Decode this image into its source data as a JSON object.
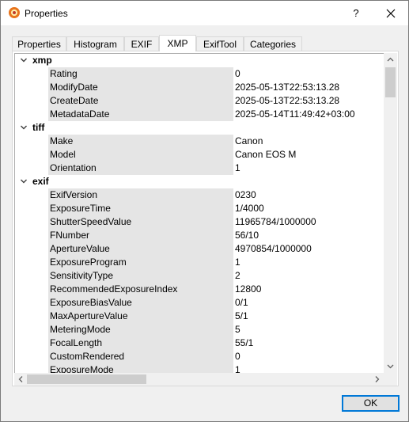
{
  "window": {
    "title": "Properties",
    "help": "?",
    "close": "✕"
  },
  "tabs": [
    "Properties",
    "Histogram",
    "EXIF",
    "XMP",
    "ExifTool",
    "Categories"
  ],
  "active_tab": "XMP",
  "groups": [
    {
      "name": "xmp",
      "rows": [
        {
          "k": "Rating",
          "v": "0"
        },
        {
          "k": "ModifyDate",
          "v": "2025-05-13T22:53:13.28"
        },
        {
          "k": "CreateDate",
          "v": "2025-05-13T22:53:13.28"
        },
        {
          "k": "MetadataDate",
          "v": "2025-05-14T11:49:42+03:00"
        }
      ]
    },
    {
      "name": "tiff",
      "rows": [
        {
          "k": "Make",
          "v": "Canon"
        },
        {
          "k": "Model",
          "v": "Canon EOS M"
        },
        {
          "k": "Orientation",
          "v": "1"
        }
      ]
    },
    {
      "name": "exif",
      "rows": [
        {
          "k": "ExifVersion",
          "v": "0230"
        },
        {
          "k": "ExposureTime",
          "v": "1/4000"
        },
        {
          "k": "ShutterSpeedValue",
          "v": "11965784/1000000"
        },
        {
          "k": "FNumber",
          "v": "56/10"
        },
        {
          "k": "ApertureValue",
          "v": "4970854/1000000"
        },
        {
          "k": "ExposureProgram",
          "v": "1"
        },
        {
          "k": "SensitivityType",
          "v": "2"
        },
        {
          "k": "RecommendedExposureIndex",
          "v": "12800"
        },
        {
          "k": "ExposureBiasValue",
          "v": "0/1"
        },
        {
          "k": "MaxApertureValue",
          "v": "5/1"
        },
        {
          "k": "MeteringMode",
          "v": "5"
        },
        {
          "k": "FocalLength",
          "v": "55/1"
        },
        {
          "k": "CustomRendered",
          "v": "0"
        },
        {
          "k": "ExposureMode",
          "v": "1"
        }
      ]
    }
  ],
  "footer": {
    "ok_label": "OK"
  }
}
